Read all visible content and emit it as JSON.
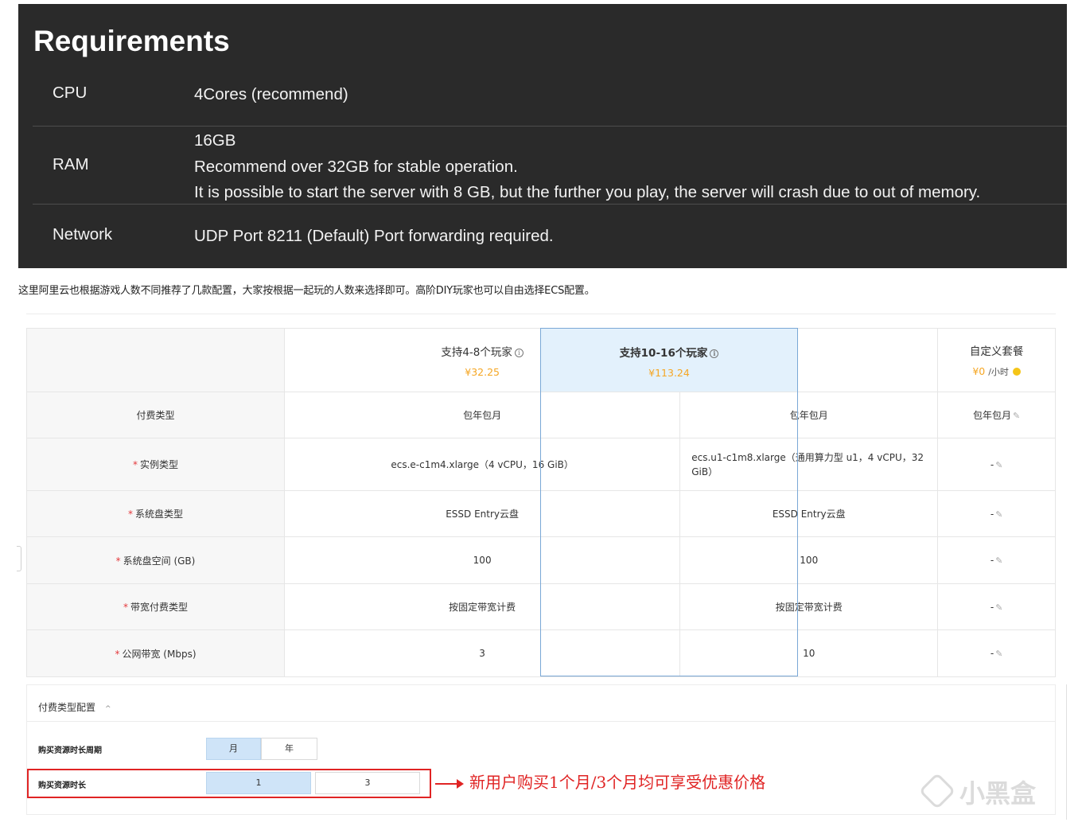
{
  "requirements": {
    "title": "Requirements",
    "rows": [
      {
        "label": "CPU",
        "lines": [
          "4Cores (recommend)"
        ]
      },
      {
        "label": "RAM",
        "lines": [
          "16GB",
          "Recommend over 32GB for stable operation.",
          "It is possible to start the server with 8 GB, but the further you play, the server will crash due to out of memory."
        ]
      },
      {
        "label": "Network",
        "lines": [
          "UDP Port 8211 (Default) Port forwarding required."
        ]
      }
    ]
  },
  "intro_text": "这里阿里云也根据游戏人数不同推荐了几款配置，大家按根据一起玩的人数来选择即可。高阶DIY玩家也可以自由选择ECS配置。",
  "plans": [
    {
      "name": "支持4-8个玩家",
      "price": "¥32.25",
      "info": "i"
    },
    {
      "name": "支持10-16个玩家",
      "price": "¥113.24",
      "info": "i"
    },
    {
      "name": "自定义套餐",
      "price": "¥0",
      "unit": "/小时"
    }
  ],
  "table_rows": [
    {
      "label": "付费类型",
      "required": false,
      "cells": [
        "包年包月",
        "包年包月",
        "包年包月"
      ]
    },
    {
      "label": "实例类型",
      "required": true,
      "cells": [
        "ecs.e-c1m4.xlarge（4 vCPU，16 GiB）",
        "ecs.u1-c1m8.xlarge（通用算力型 u1，4 vCPU，32 GiB）",
        "-"
      ]
    },
    {
      "label": "系统盘类型",
      "required": true,
      "cells": [
        "ESSD Entry云盘",
        "ESSD Entry云盘",
        "-"
      ]
    },
    {
      "label": "系统盘空间 (GB)",
      "required": true,
      "cells": [
        "100",
        "100",
        "-"
      ]
    },
    {
      "label": "带宽付费类型",
      "required": true,
      "cells": [
        "按固定带宽计费",
        "按固定带宽计费",
        "-"
      ]
    },
    {
      "label": "公网带宽 (Mbps)",
      "required": true,
      "cells": [
        "3",
        "10",
        "-"
      ]
    }
  ],
  "payment": {
    "title": "付费类型配置",
    "cycle_label": "购买资源时长周期",
    "cycle_options": [
      "月",
      "年"
    ],
    "duration_label": "购买资源时长",
    "duration_options": [
      "1",
      "3"
    ]
  },
  "annotation": "新用户购买1个月/3个月均可享受优惠价格",
  "watermark": "小黑盒",
  "colors": {
    "accent": "#f5a623",
    "highlight_bg": "#e3f1fc",
    "annotation": "#e02424",
    "dark_panel": "#2a2a2a"
  }
}
